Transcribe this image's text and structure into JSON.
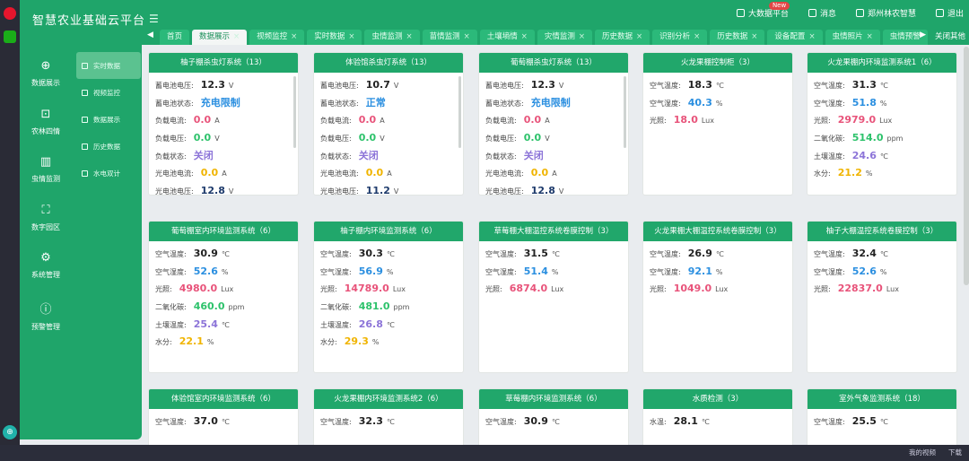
{
  "app": {
    "title": "智慧农业基础云平台",
    "menu_toggle_glyph": "☰",
    "top_actions": [
      {
        "icon": "bigdata-icon",
        "label": "大数据平台",
        "badge": "New"
      },
      {
        "icon": "message-icon",
        "label": "消息"
      },
      {
        "icon": "user-icon",
        "label": "郑州林农智慧"
      },
      {
        "icon": "logout-icon",
        "label": "退出"
      }
    ],
    "tabs": [
      {
        "label": "首页",
        "closable": false
      },
      {
        "label": "数据展示",
        "closable": true,
        "active": true
      },
      {
        "label": "视频监控",
        "closable": true
      },
      {
        "label": "实时数据",
        "closable": true
      },
      {
        "label": "虫情监测",
        "closable": true
      },
      {
        "label": "苗情监测",
        "closable": true
      },
      {
        "label": "土壤墒情",
        "closable": true
      },
      {
        "label": "灾情监测",
        "closable": true
      },
      {
        "label": "历史数据",
        "closable": true
      },
      {
        "label": "识别分析",
        "closable": true
      },
      {
        "label": "历史数据",
        "closable": true
      },
      {
        "label": "设备配置",
        "closable": true
      },
      {
        "label": "虫情照片",
        "closable": true
      },
      {
        "label": "虫情预警",
        "closable": false
      }
    ],
    "tab_close_all": "关闭其他",
    "colors": {
      "brand": "#1fa56a",
      "header": "#21a76b",
      "red": "#e8537a",
      "green": "#2dc26b",
      "blue": "#2b8fe0",
      "purple": "#8c74d8",
      "orange": "#f0b400"
    }
  },
  "sidebar": {
    "main": [
      {
        "icon": "globe-icon",
        "label": "数据展示"
      },
      {
        "icon": "briefcase-icon",
        "label": "农林四情"
      },
      {
        "icon": "chart-icon",
        "label": "虫情监测"
      },
      {
        "icon": "expand-icon",
        "label": "数字园区"
      },
      {
        "icon": "gear-icon",
        "label": "系统管理"
      },
      {
        "icon": "alert-icon",
        "label": "预警管理"
      }
    ],
    "sub": [
      {
        "label": "实时数据",
        "active": true
      },
      {
        "label": "视频监控"
      },
      {
        "label": "数据展示"
      },
      {
        "label": "历史数据"
      },
      {
        "label": "水电双计"
      }
    ]
  },
  "cards": [
    {
      "title": "柚子棚杀虫灯系统（13）",
      "scroll": true,
      "rows": [
        {
          "label": "蓄电池电压:",
          "value": "12.3",
          "unit": "V",
          "color": "#222"
        },
        {
          "label": "蓄电池状态:",
          "value": "充电限制",
          "unit": "",
          "color": "#2b8fe0"
        },
        {
          "label": "负载电流:",
          "value": "0.0",
          "unit": "A",
          "color": "#e8537a"
        },
        {
          "label": "负载电压:",
          "value": "0.0",
          "unit": "V",
          "color": "#2dc26b"
        },
        {
          "label": "负载状态:",
          "value": "关闭",
          "unit": "",
          "color": "#8c74d8"
        },
        {
          "label": "光电池电流:",
          "value": "0.0",
          "unit": "A",
          "color": "#f0b400"
        },
        {
          "label": "光电池电压:",
          "value": "12.8",
          "unit": "V",
          "color": "#1d3a6b"
        }
      ]
    },
    {
      "title": "体验馆杀虫灯系统（13）",
      "scroll": true,
      "rows": [
        {
          "label": "蓄电池电压:",
          "value": "10.7",
          "unit": "V",
          "color": "#222"
        },
        {
          "label": "蓄电池状态:",
          "value": "正常",
          "unit": "",
          "color": "#2b8fe0"
        },
        {
          "label": "负载电流:",
          "value": "0.0",
          "unit": "A",
          "color": "#e8537a"
        },
        {
          "label": "负载电压:",
          "value": "0.0",
          "unit": "V",
          "color": "#2dc26b"
        },
        {
          "label": "负载状态:",
          "value": "关闭",
          "unit": "",
          "color": "#8c74d8"
        },
        {
          "label": "光电池电流:",
          "value": "0.0",
          "unit": "A",
          "color": "#f0b400"
        },
        {
          "label": "光电池电压:",
          "value": "11.2",
          "unit": "V",
          "color": "#1d3a6b"
        }
      ]
    },
    {
      "title": "葡萄棚杀虫灯系统（13）",
      "scroll": true,
      "rows": [
        {
          "label": "蓄电池电压:",
          "value": "12.3",
          "unit": "V",
          "color": "#222"
        },
        {
          "label": "蓄电池状态:",
          "value": "充电限制",
          "unit": "",
          "color": "#2b8fe0"
        },
        {
          "label": "负载电流:",
          "value": "0.0",
          "unit": "A",
          "color": "#e8537a"
        },
        {
          "label": "负载电压:",
          "value": "0.0",
          "unit": "V",
          "color": "#2dc26b"
        },
        {
          "label": "负载状态:",
          "value": "关闭",
          "unit": "",
          "color": "#8c74d8"
        },
        {
          "label": "光电池电流:",
          "value": "0.0",
          "unit": "A",
          "color": "#f0b400"
        },
        {
          "label": "光电池电压:",
          "value": "12.8",
          "unit": "V",
          "color": "#1d3a6b"
        }
      ]
    },
    {
      "title": "火龙果棚控制柜（3）",
      "rows": [
        {
          "label": "空气温度:",
          "value": "18.3",
          "unit": "℃",
          "color": "#222"
        },
        {
          "label": "空气湿度:",
          "value": "40.3",
          "unit": "%",
          "color": "#2b8fe0"
        },
        {
          "label": "光照:",
          "value": "18.0",
          "unit": "Lux",
          "color": "#e8537a"
        }
      ]
    },
    {
      "title": "火龙果棚内环境监测系统1（6）",
      "rows": [
        {
          "label": "空气温度:",
          "value": "31.3",
          "unit": "℃",
          "color": "#222"
        },
        {
          "label": "空气湿度:",
          "value": "51.8",
          "unit": "%",
          "color": "#2b8fe0"
        },
        {
          "label": "光照:",
          "value": "2979.0",
          "unit": "Lux",
          "color": "#e8537a"
        },
        {
          "label": "二氧化碳:",
          "value": "514.0",
          "unit": "ppm",
          "color": "#2dc26b"
        },
        {
          "label": "土壤温度:",
          "value": "24.6",
          "unit": "℃",
          "color": "#8c74d8"
        },
        {
          "label": "水分:",
          "value": "21.2",
          "unit": "%",
          "color": "#f0b400"
        }
      ]
    },
    {
      "title": "葡萄棚室内环境监测系统（6）",
      "rows": [
        {
          "label": "空气温度:",
          "value": "30.9",
          "unit": "℃",
          "color": "#222"
        },
        {
          "label": "空气湿度:",
          "value": "52.6",
          "unit": "%",
          "color": "#2b8fe0"
        },
        {
          "label": "光照:",
          "value": "4980.0",
          "unit": "Lux",
          "color": "#e8537a"
        },
        {
          "label": "二氧化碳:",
          "value": "460.0",
          "unit": "ppm",
          "color": "#2dc26b"
        },
        {
          "label": "土壤温度:",
          "value": "25.4",
          "unit": "℃",
          "color": "#8c74d8"
        },
        {
          "label": "水分:",
          "value": "22.1",
          "unit": "%",
          "color": "#f0b400"
        }
      ]
    },
    {
      "title": "柚子棚内环境监测系统（6）",
      "rows": [
        {
          "label": "空气温度:",
          "value": "30.3",
          "unit": "℃",
          "color": "#222"
        },
        {
          "label": "空气湿度:",
          "value": "56.9",
          "unit": "%",
          "color": "#2b8fe0"
        },
        {
          "label": "光照:",
          "value": "14789.0",
          "unit": "Lux",
          "color": "#e8537a"
        },
        {
          "label": "二氧化碳:",
          "value": "481.0",
          "unit": "ppm",
          "color": "#2dc26b"
        },
        {
          "label": "土壤温度:",
          "value": "26.8",
          "unit": "℃",
          "color": "#8c74d8"
        },
        {
          "label": "水分:",
          "value": "29.3",
          "unit": "%",
          "color": "#f0b400"
        }
      ]
    },
    {
      "title": "草莓棚大棚温控系统卷膜控制（3）",
      "rows": [
        {
          "label": "空气温度:",
          "value": "31.5",
          "unit": "℃",
          "color": "#222"
        },
        {
          "label": "空气湿度:",
          "value": "51.4",
          "unit": "%",
          "color": "#2b8fe0"
        },
        {
          "label": "光照:",
          "value": "6874.0",
          "unit": "Lux",
          "color": "#e8537a"
        }
      ]
    },
    {
      "title": "火龙果棚大棚温控系统卷膜控制（3）",
      "rows": [
        {
          "label": "空气温度:",
          "value": "26.9",
          "unit": "℃",
          "color": "#222"
        },
        {
          "label": "空气湿度:",
          "value": "92.1",
          "unit": "%",
          "color": "#2b8fe0"
        },
        {
          "label": "光照:",
          "value": "1049.0",
          "unit": "Lux",
          "color": "#e8537a"
        }
      ]
    },
    {
      "title": "柚子大棚温控系统卷膜控制（3）",
      "rows": [
        {
          "label": "空气温度:",
          "value": "32.4",
          "unit": "℃",
          "color": "#222"
        },
        {
          "label": "空气湿度:",
          "value": "52.6",
          "unit": "%",
          "color": "#2b8fe0"
        },
        {
          "label": "光照:",
          "value": "22837.0",
          "unit": "Lux",
          "color": "#e8537a"
        }
      ]
    },
    {
      "title": "体验馆室内环境监测系统（6）",
      "rows": [
        {
          "label": "空气温度:",
          "value": "37.0",
          "unit": "℃",
          "color": "#222"
        }
      ]
    },
    {
      "title": "火龙果棚内环境监测系统2（6）",
      "rows": [
        {
          "label": "空气温度:",
          "value": "32.3",
          "unit": "℃",
          "color": "#222"
        }
      ]
    },
    {
      "title": "草莓棚内环境监测系统（6）",
      "rows": [
        {
          "label": "空气温度:",
          "value": "30.9",
          "unit": "℃",
          "color": "#222"
        }
      ]
    },
    {
      "title": "水质检测（3）",
      "rows": [
        {
          "label": "水温:",
          "value": "28.1",
          "unit": "℃",
          "color": "#222"
        }
      ]
    },
    {
      "title": "室外气象监测系统（18）",
      "rows": [
        {
          "label": "空气温度:",
          "value": "25.5",
          "unit": "℃",
          "color": "#222"
        }
      ]
    }
  ],
  "taskbar": {
    "items": [
      "我的视频",
      "下载"
    ]
  }
}
